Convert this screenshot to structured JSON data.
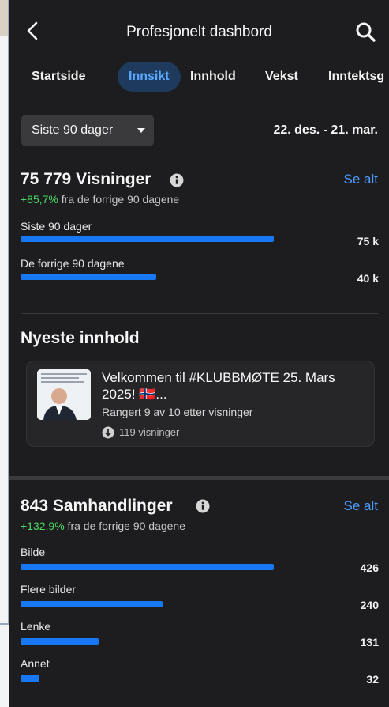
{
  "header": {
    "title": "Profesjonelt dashbord"
  },
  "tabs": [
    {
      "label": "Startside"
    },
    {
      "label": "Innsikt",
      "active": true
    },
    {
      "label": "Innhold"
    },
    {
      "label": "Vekst"
    },
    {
      "label": "Inntektsg"
    }
  ],
  "filter": {
    "period_label": "Siste 90 dager",
    "date_range": "22. des. - 21. mar."
  },
  "views": {
    "title": "75 779 Visninger",
    "see_all": "Se alt",
    "change_pct": "+85,7%",
    "change_text": " fra de forrige 90 dagene",
    "rows": [
      {
        "label": "Siste 90 dager",
        "value": "75 k",
        "fraction": 0.73
      },
      {
        "label": "De forrige 90 dagene",
        "value": "40 k",
        "fraction": 0.39
      }
    ]
  },
  "latest": {
    "heading": "Nyeste innhold",
    "card": {
      "title": "Velkommen til #KLUBBMØTE 25. Mars 2025! 🇳🇴...",
      "rank": "Rangert 9 av 10 etter visninger",
      "views": "119 visninger"
    }
  },
  "interactions": {
    "title": "843 Samhandlinger",
    "see_all": "Se alt",
    "change_pct": "+132,9%",
    "change_text": " fra de forrige 90 dagene",
    "rows": [
      {
        "label": "Bilde",
        "value": "426",
        "fraction": 0.73
      },
      {
        "label": "Flere bilder",
        "value": "240",
        "fraction": 0.41
      },
      {
        "label": "Lenke",
        "value": "131",
        "fraction": 0.225
      },
      {
        "label": "Annet",
        "value": "32",
        "fraction": 0.055
      }
    ]
  },
  "colors": {
    "background": "#1d1d1f",
    "accent_blue": "#1877f2",
    "link_blue": "#4c9cff",
    "positive_green": "#4cd964",
    "active_tab_bg": "#1e3a5c"
  },
  "icons": [
    "back-chevron-icon",
    "search-icon",
    "chevron-down-icon",
    "info-icon",
    "download-circle-icon"
  ]
}
